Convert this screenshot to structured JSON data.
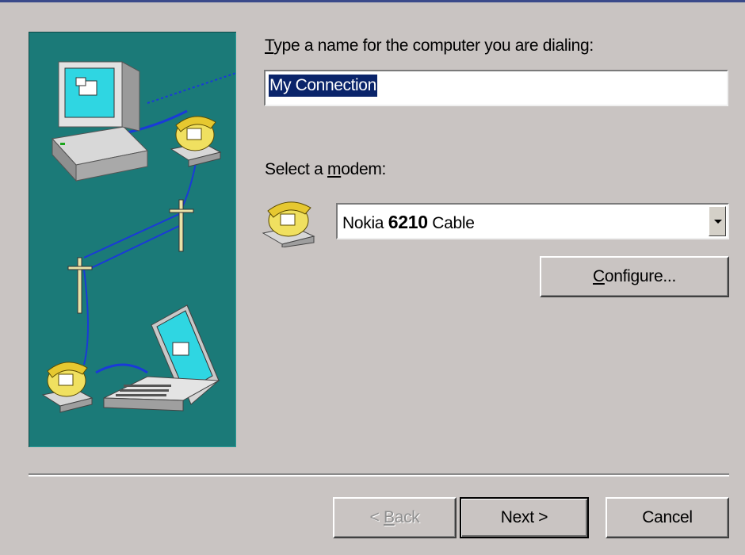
{
  "dialog": {
    "name_prompt": {
      "mnemonic": "T",
      "rest": "ype a name for the computer you are dialing:"
    },
    "name_value": "My Connection",
    "modem_prompt": {
      "before": "Select a ",
      "mnemonic": "m",
      "after": "odem:"
    },
    "modem_value": {
      "prefix": "Nokia ",
      "model": "6210",
      "suffix": " Cable"
    },
    "configure_button": {
      "mnemonic": "C",
      "rest": "onfigure..."
    },
    "back_button": {
      "prefix": "< ",
      "mnemonic": "B",
      "rest": "ack"
    },
    "next_button": "Next >",
    "cancel_button": "Cancel"
  },
  "colors": {
    "dialog_bg": "#c9c4c2",
    "art_bg": "#1b7a78",
    "selection": "#0a246a"
  },
  "icons": [
    "computer-icon",
    "telephone-icon",
    "telephone-pole-icon",
    "laptop-icon",
    "modem-telephone-icon",
    "dropdown-arrow-icon"
  ]
}
